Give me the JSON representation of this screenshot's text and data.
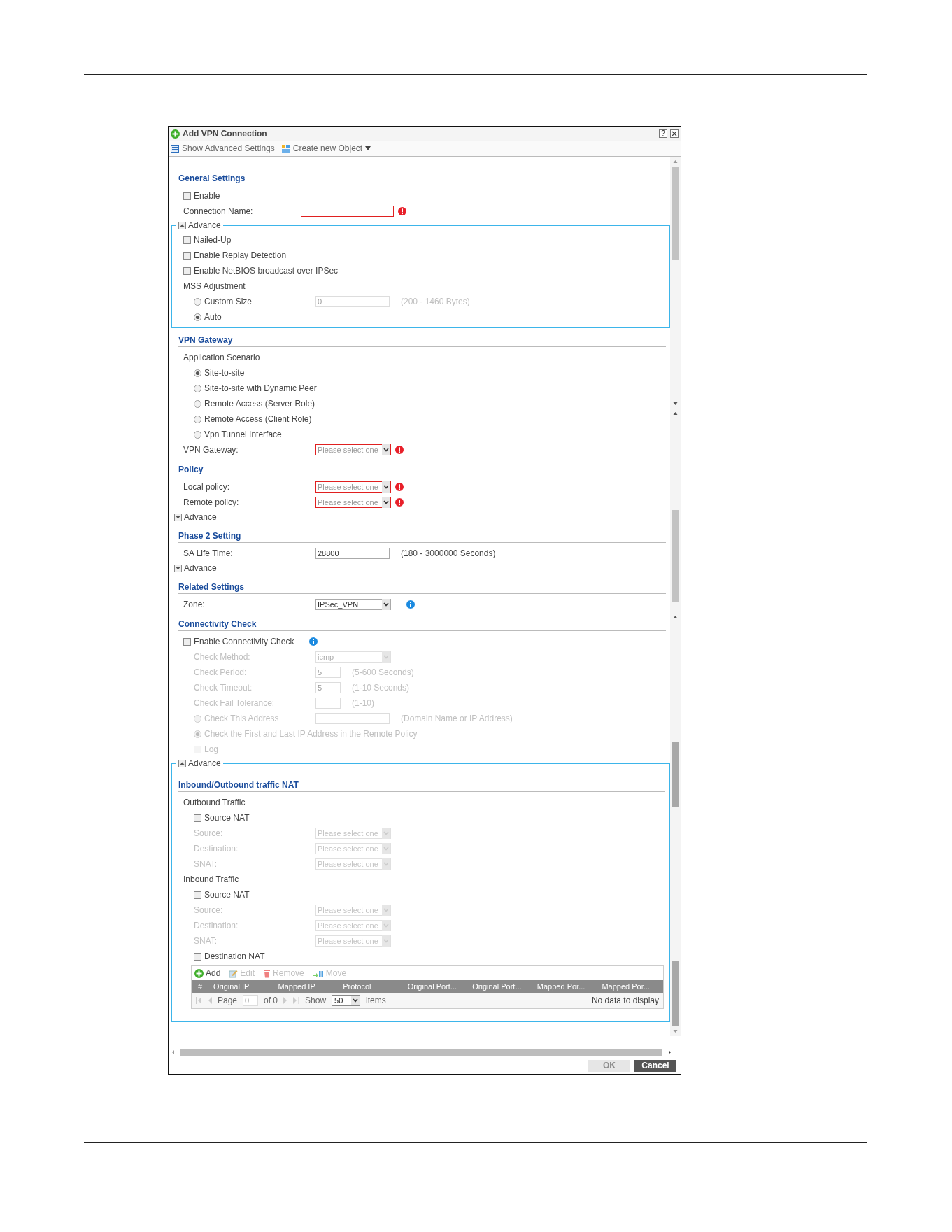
{
  "dialog": {
    "title": "Add VPN Connection",
    "help": "?",
    "toolbar": [
      {
        "kind": "settings",
        "label": "Show Advanced Settings"
      },
      {
        "kind": "object",
        "label": "Create new Object",
        "dropdown": true
      }
    ],
    "content": [
      {
        "kind": "section",
        "title": "General Settings",
        "children": [
          {
            "kind": "checkbox",
            "label": "Enable",
            "checked": false
          },
          {
            "kind": "field",
            "label": "Connection Name:",
            "required": true
          }
        ]
      },
      {
        "kind": "fieldset",
        "label": "Advance",
        "expanded": true,
        "children": [
          {
            "kind": "checkbox",
            "label": "Nailed-Up",
            "checked": false
          },
          {
            "kind": "checkbox",
            "label": "Enable Replay Detection",
            "checked": false
          },
          {
            "kind": "checkbox",
            "label": "Enable NetBIOS broadcast over IPSec",
            "checked": false
          },
          {
            "kind": "group",
            "label": "MSS Adjustment",
            "children": [
              {
                "kind": "radio",
                "label": "Custom Size",
                "selected": false,
                "field": {
                  "value": "0",
                  "disabled": true
                },
                "hint": "(200 - 1460 Bytes)"
              },
              {
                "kind": "radio",
                "label": "Auto",
                "selected": true
              }
            ]
          }
        ]
      },
      {
        "kind": "section",
        "title": "VPN Gateway",
        "children": [
          {
            "kind": "group",
            "label": "Application Scenario",
            "children": [
              {
                "kind": "radio",
                "label": "Site-to-site",
                "selected": true
              },
              {
                "kind": "radio",
                "label": "Site-to-site with Dynamic Peer",
                "selected": false
              },
              {
                "kind": "radio",
                "label": "Remote Access (Server Role)",
                "selected": false
              },
              {
                "kind": "radio",
                "label": "Remote Access (Client Role)",
                "selected": false
              },
              {
                "kind": "radio",
                "label": "Vpn Tunnel Interface",
                "selected": false
              }
            ]
          },
          {
            "kind": "select",
            "label": "VPN Gateway:",
            "placeholder": "Please select one",
            "required": true
          }
        ]
      },
      {
        "kind": "section",
        "title": "Policy",
        "children": [
          {
            "kind": "select",
            "label": "Local policy:",
            "placeholder": "Please select one",
            "required": true
          },
          {
            "kind": "select",
            "label": "Remote policy:",
            "placeholder": "Please select one",
            "required": true
          },
          {
            "kind": "advance",
            "label": "Advance",
            "expanded": false
          }
        ]
      },
      {
        "kind": "section",
        "title": "Phase 2 Setting",
        "children": [
          {
            "kind": "field",
            "label": "SA Life Time:",
            "value": "28800",
            "hint": "(180 - 3000000 Seconds)"
          },
          {
            "kind": "advance",
            "label": "Advance",
            "expanded": false
          }
        ]
      },
      {
        "kind": "section",
        "title": "Related Settings",
        "children": [
          {
            "kind": "select",
            "label": "Zone:",
            "value": "IPSec_VPN",
            "info": true
          }
        ]
      },
      {
        "kind": "section",
        "title": "Connectivity Check",
        "children": [
          {
            "kind": "checkbox",
            "label": "Enable Connectivity Check",
            "checked": false,
            "info": true,
            "children": [
              {
                "kind": "select",
                "label": "Check Method:",
                "value": "icmp",
                "disabled": true
              },
              {
                "kind": "short_field",
                "label": "Check Period:",
                "value": "5",
                "hint": "(5-600 Seconds)",
                "disabled": true
              },
              {
                "kind": "short_field",
                "label": "Check Timeout:",
                "value": "5",
                "hint": "(1-10 Seconds)",
                "disabled": true
              },
              {
                "kind": "short_field",
                "label": "Check Fail Tolerance:",
                "hint": "(1-10)",
                "disabled": true
              },
              {
                "kind": "radio",
                "label": "Check This Address",
                "selected": false,
                "disabled": true,
                "field": {
                  "disabled": true
                },
                "hint": "(Domain Name or IP Address)"
              },
              {
                "kind": "radio",
                "label": "Check the First and Last IP Address in the Remote Policy",
                "selected": true,
                "disabled": true
              },
              {
                "kind": "checkbox",
                "label": "Log",
                "checked": false,
                "disabled": true
              }
            ]
          }
        ]
      },
      {
        "kind": "fieldset",
        "label": "Advance",
        "expanded": true,
        "children": [
          {
            "kind": "section",
            "title": "Inbound/Outbound traffic NAT",
            "children": [
              {
                "kind": "group",
                "label": "Outbound Traffic",
                "children": [
                  {
                    "kind": "checkbox",
                    "label": "Source NAT",
                    "checked": false
                  },
                  {
                    "kind": "select",
                    "label": "Source:",
                    "placeholder": "Please select one",
                    "disabled": true
                  },
                  {
                    "kind": "select",
                    "label": "Destination:",
                    "placeholder": "Please select one",
                    "disabled": true
                  },
                  {
                    "kind": "select",
                    "label": "SNAT:",
                    "placeholder": "Please select one",
                    "disabled": true
                  }
                ]
              },
              {
                "kind": "group",
                "label": "Inbound Traffic",
                "children": [
                  {
                    "kind": "checkbox",
                    "label": "Source NAT",
                    "checked": false
                  },
                  {
                    "kind": "select",
                    "label": "Source:",
                    "placeholder": "Please select one",
                    "disabled": true
                  },
                  {
                    "kind": "select",
                    "label": "Destination:",
                    "placeholder": "Please select one",
                    "disabled": true
                  },
                  {
                    "kind": "select",
                    "label": "SNAT:",
                    "placeholder": "Please select one",
                    "disabled": true
                  },
                  {
                    "kind": "checkbox",
                    "label": "Destination NAT",
                    "checked": false
                  },
                  {
                    "kind": "table",
                    "actions": [
                      {
                        "kind": "add",
                        "label": "Add",
                        "disabled": false
                      },
                      {
                        "kind": "edit",
                        "label": "Edit",
                        "disabled": true
                      },
                      {
                        "kind": "remove",
                        "label": "Remove",
                        "disabled": true
                      },
                      {
                        "kind": "move",
                        "label": "Move",
                        "disabled": true
                      }
                    ],
                    "columns": [
                      "#",
                      "Original IP",
                      "Mapped IP",
                      "Protocol",
                      "Original Port...",
                      "Original Port...",
                      "Mapped Por...",
                      "Mapped Por..."
                    ],
                    "pager": {
                      "page_label": "Page",
                      "page": "0",
                      "of": "of 0",
                      "show_label": "Show",
                      "per_page": "50",
                      "items_label": "items",
                      "empty": "No data to display"
                    }
                  }
                ]
              }
            ]
          }
        ]
      }
    ],
    "footer_buttons": [
      {
        "label": "OK",
        "disabled": true
      },
      {
        "label": "Cancel",
        "disabled": false
      }
    ]
  }
}
